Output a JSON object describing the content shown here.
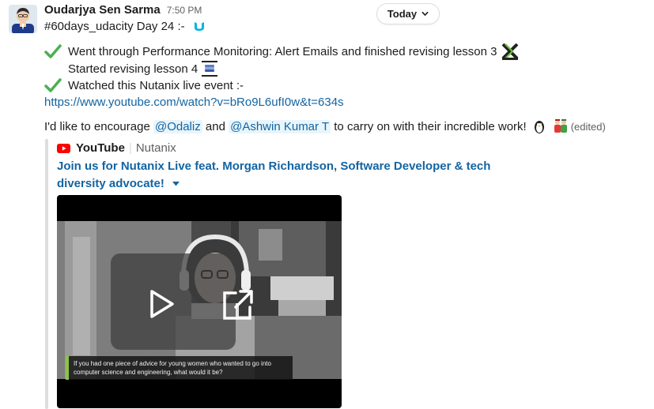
{
  "message": {
    "sender": "Oudarjya Sen Sarma",
    "time": "7:50 PM",
    "date_divider": "Today",
    "line_intro": "#60days_udacity  Day 24 :-",
    "line_1": "Went through Performance Monitoring: Alert Emails and finished revising lesson 3",
    "line_2": "Started revising lesson 4",
    "line_3": "Watched this Nutanix live event :-",
    "url": "https://www.youtube.com/watch?v=bRo9L6ufI0w&t=634s",
    "encourage_prefix": "I'd like to encourage",
    "mention_1": "@Odaliz",
    "conjunction": "and",
    "mention_2": "@Ashwin Kumar T",
    "encourage_suffix": "to carry on with their incredible work!",
    "edited_label": "(edited)"
  },
  "unfurl": {
    "source": "YouTube",
    "channel": "Nutanix",
    "title": "Join us for Nutanix Live feat. Morgan Richardson, Software Developer & tech diversity advocate!",
    "caption": "If you had one piece of advice for young women who wanted to go into computer science and engineering, what would it be?"
  },
  "colors": {
    "link": "#1264a3",
    "mention_bg": "#e8f5fa",
    "check_green": "#4caf50",
    "youtube_red": "#ff0000"
  },
  "icons": [
    "check-mark-icon",
    "udacity-icon",
    "chevron-down-icon",
    "youtube-logo-icon",
    "play-icon",
    "external-link-icon"
  ]
}
